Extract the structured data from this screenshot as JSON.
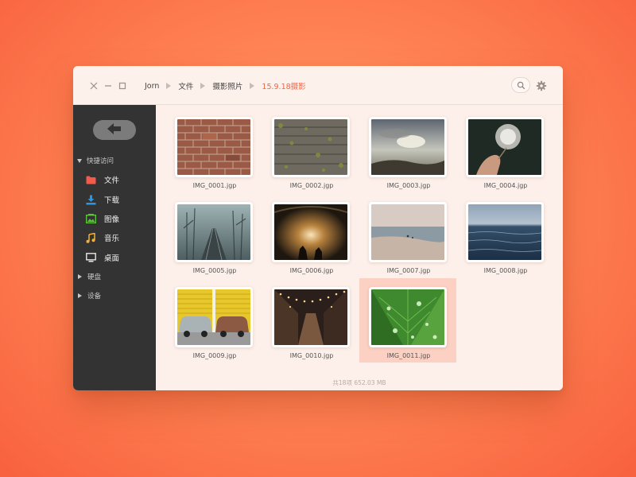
{
  "breadcrumb": [
    "Jorn",
    "文件",
    "摄影照片",
    "15.9.18摄影"
  ],
  "sidebar": {
    "quick_access": "快捷访问",
    "items": [
      {
        "label": "文件",
        "icon": "folder-icon",
        "color": "#f25a4c"
      },
      {
        "label": "下载",
        "icon": "download-icon",
        "color": "#2b95e6"
      },
      {
        "label": "图像",
        "icon": "image-icon",
        "color": "#5fc23c"
      },
      {
        "label": "音乐",
        "icon": "music-icon",
        "color": "#f2b134"
      },
      {
        "label": "桌面",
        "icon": "desktop-icon",
        "color": "#e6e6e6"
      }
    ],
    "drives": "硬盘",
    "devices": "设备"
  },
  "files": [
    {
      "name": "IMG_0001.jgp"
    },
    {
      "name": "IMG_0002.jgp"
    },
    {
      "name": "IMG_0003.jgp"
    },
    {
      "name": "IMG_0004.jgp"
    },
    {
      "name": "IMG_0005.jgp"
    },
    {
      "name": "IMG_0006.jgp"
    },
    {
      "name": "IMG_0007.jgp"
    },
    {
      "name": "IMG_0008.jgp"
    },
    {
      "name": "IMG_0009.jgp"
    },
    {
      "name": "IMG_0010.jgp"
    },
    {
      "name": "IMG_0011.jgp",
      "selected": true
    }
  ],
  "status": "共18项  652.03 MB",
  "accent": "#f6643f"
}
